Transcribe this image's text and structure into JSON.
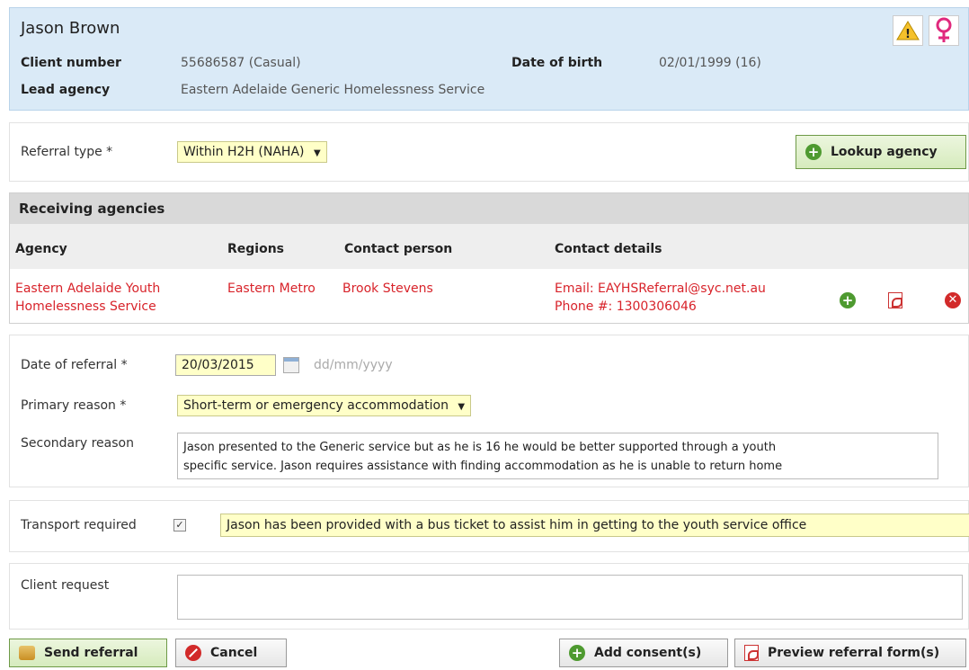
{
  "client": {
    "name": "Jason Brown",
    "client_number_label": "Client number",
    "client_number": "55686587 (Casual)",
    "dob_label": "Date of birth",
    "dob": "02/01/1999 (16)",
    "lead_agency_label": "Lead agency",
    "lead_agency": "Eastern Adelaide Generic Homelessness Service"
  },
  "referral": {
    "type_label": "Referral type *",
    "type_value": "Within H2H (NAHA)",
    "lookup_label": "Lookup agency"
  },
  "receiving": {
    "title": "Receiving agencies",
    "columns": [
      "Agency",
      "Regions",
      "Contact person",
      "Contact details"
    ],
    "row": {
      "agency_line1": "Eastern Adelaide Youth",
      "agency_line2": "Homelessness Service",
      "region": "Eastern Metro",
      "contact": "Brook Stevens",
      "email": "Email: EAYHSReferral@syc.net.au",
      "phone": "Phone #: 1300306046"
    }
  },
  "form": {
    "date_label": "Date of referral *",
    "date_value": "20/03/2015",
    "date_hint": "dd/mm/yyyy",
    "primary_label": "Primary reason *",
    "primary_value": "Short-term or emergency accommodation",
    "secondary_label": "Secondary reason",
    "secondary_line1": "Jason presented to the Generic service but as he is 16 he would be better supported through a youth",
    "secondary_line2": "specific service. Jason requires assistance with finding accommodation as he is unable to return home",
    "transport_label": "Transport required",
    "transport_checked": true,
    "transport_note": "Jason has been provided with a bus ticket to assist him in getting to the youth service office",
    "request_label": "Client request",
    "request_value": ""
  },
  "actions": {
    "send": "Send referral",
    "cancel": "Cancel",
    "add_consent": "Add consent(s)",
    "preview": "Preview referral form(s)"
  },
  "colors": {
    "header_bg": "#daeaf7",
    "highlight_field": "#ffffc8",
    "agency_red": "#d8232a",
    "accent_green": "#4e9a30"
  }
}
